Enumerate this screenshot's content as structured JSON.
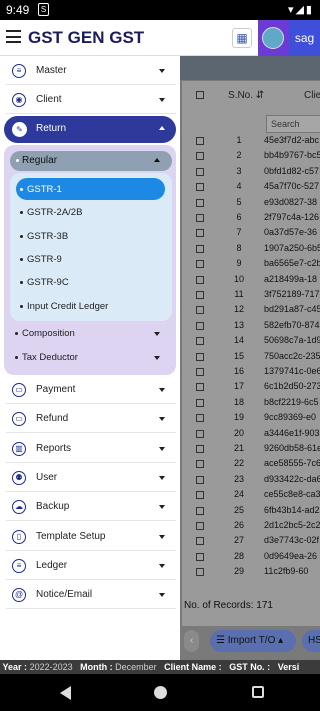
{
  "status_bar": {
    "time": "9:49",
    "notification_icon": "S"
  },
  "header": {
    "title": "GST GEN GST",
    "user_label": "sag"
  },
  "drawer": {
    "top_items": [
      {
        "label": "Master",
        "icon": "database-icon"
      },
      {
        "label": "Client",
        "icon": "person-icon"
      }
    ],
    "return": {
      "label": "Return",
      "icon": "edit-icon",
      "regular_label": "Regular",
      "regular_items": [
        "GSTR-1",
        "GSTR-2A/2B",
        "GSTR-3B",
        "GSTR-9",
        "GSTR-9C",
        "Input Credit Ledger"
      ],
      "active_item": "GSTR-1",
      "groups": [
        "Composition",
        "Tax Deductor"
      ]
    },
    "bottom_items": [
      {
        "label": "Payment",
        "icon": "money-icon"
      },
      {
        "label": "Refund",
        "icon": "money-icon"
      },
      {
        "label": "Reports",
        "icon": "bar-chart-icon"
      },
      {
        "label": "User",
        "icon": "users-icon"
      },
      {
        "label": "Backup",
        "icon": "cloud-upload-icon"
      },
      {
        "label": "Template Setup",
        "icon": "columns-icon"
      },
      {
        "label": "Ledger",
        "icon": "list-icon"
      },
      {
        "label": "Notice/Email",
        "icon": "at-icon"
      }
    ]
  },
  "table": {
    "col_sno": "S.No.",
    "col_client": "Clie",
    "search_placeholder": "Search",
    "rows": [
      {
        "sno": "1",
        "id": "45e3f7d2-abc"
      },
      {
        "sno": "2",
        "id": "bb4b9767-bc5"
      },
      {
        "sno": "3",
        "id": "0bfd1d82-c57"
      },
      {
        "sno": "4",
        "id": "45a7f70c-527"
      },
      {
        "sno": "5",
        "id": "e93d0827-38"
      },
      {
        "sno": "6",
        "id": "2f797c4a-126"
      },
      {
        "sno": "7",
        "id": "0a37d57e-36"
      },
      {
        "sno": "8",
        "id": "1907a250-6b5"
      },
      {
        "sno": "9",
        "id": "ba6565e7-c2b"
      },
      {
        "sno": "10",
        "id": "a218499a-18"
      },
      {
        "sno": "11",
        "id": "3f752189-717"
      },
      {
        "sno": "12",
        "id": "bd291a87-c45"
      },
      {
        "sno": "13",
        "id": "582efb70-874"
      },
      {
        "sno": "14",
        "id": "50698c7a-1d9"
      },
      {
        "sno": "15",
        "id": "750acc2c-235"
      },
      {
        "sno": "16",
        "id": "1379741c-0e6"
      },
      {
        "sno": "17",
        "id": "6c1b2d50-273"
      },
      {
        "sno": "18",
        "id": "b8cf2219-6c5"
      },
      {
        "sno": "19",
        "id": "9cc89369-e0"
      },
      {
        "sno": "20",
        "id": "a3446e1f-903"
      },
      {
        "sno": "21",
        "id": "9260db58-61e"
      },
      {
        "sno": "22",
        "id": "ace58555-7c6"
      },
      {
        "sno": "23",
        "id": "d933422c-da6"
      },
      {
        "sno": "24",
        "id": "ce55c8e8-ca3"
      },
      {
        "sno": "25",
        "id": "6fb43b14-ad2"
      },
      {
        "sno": "26",
        "id": "2d1c2bc5-2c2"
      },
      {
        "sno": "27",
        "id": "d3e7743c-02f"
      },
      {
        "sno": "28",
        "id": "0d9649ea-26"
      },
      {
        "sno": "29",
        "id": "11c2fb9-60"
      }
    ],
    "records_label": "No. of Records: 171",
    "import_button": "Import T/O",
    "hs_button": "HS"
  },
  "footer": {
    "year_label": "Year :",
    "year_value": "2022-2023",
    "month_label": "Month :",
    "month_value": "December",
    "client_label": "Client Name :",
    "gst_label": "GST No. :",
    "version_label": "Versi"
  },
  "colors": {
    "return_header": "#2d3a9c",
    "active_item": "#1e88e5",
    "user_purple": "#6c3bd6",
    "user_blue": "#3f4fd9"
  }
}
